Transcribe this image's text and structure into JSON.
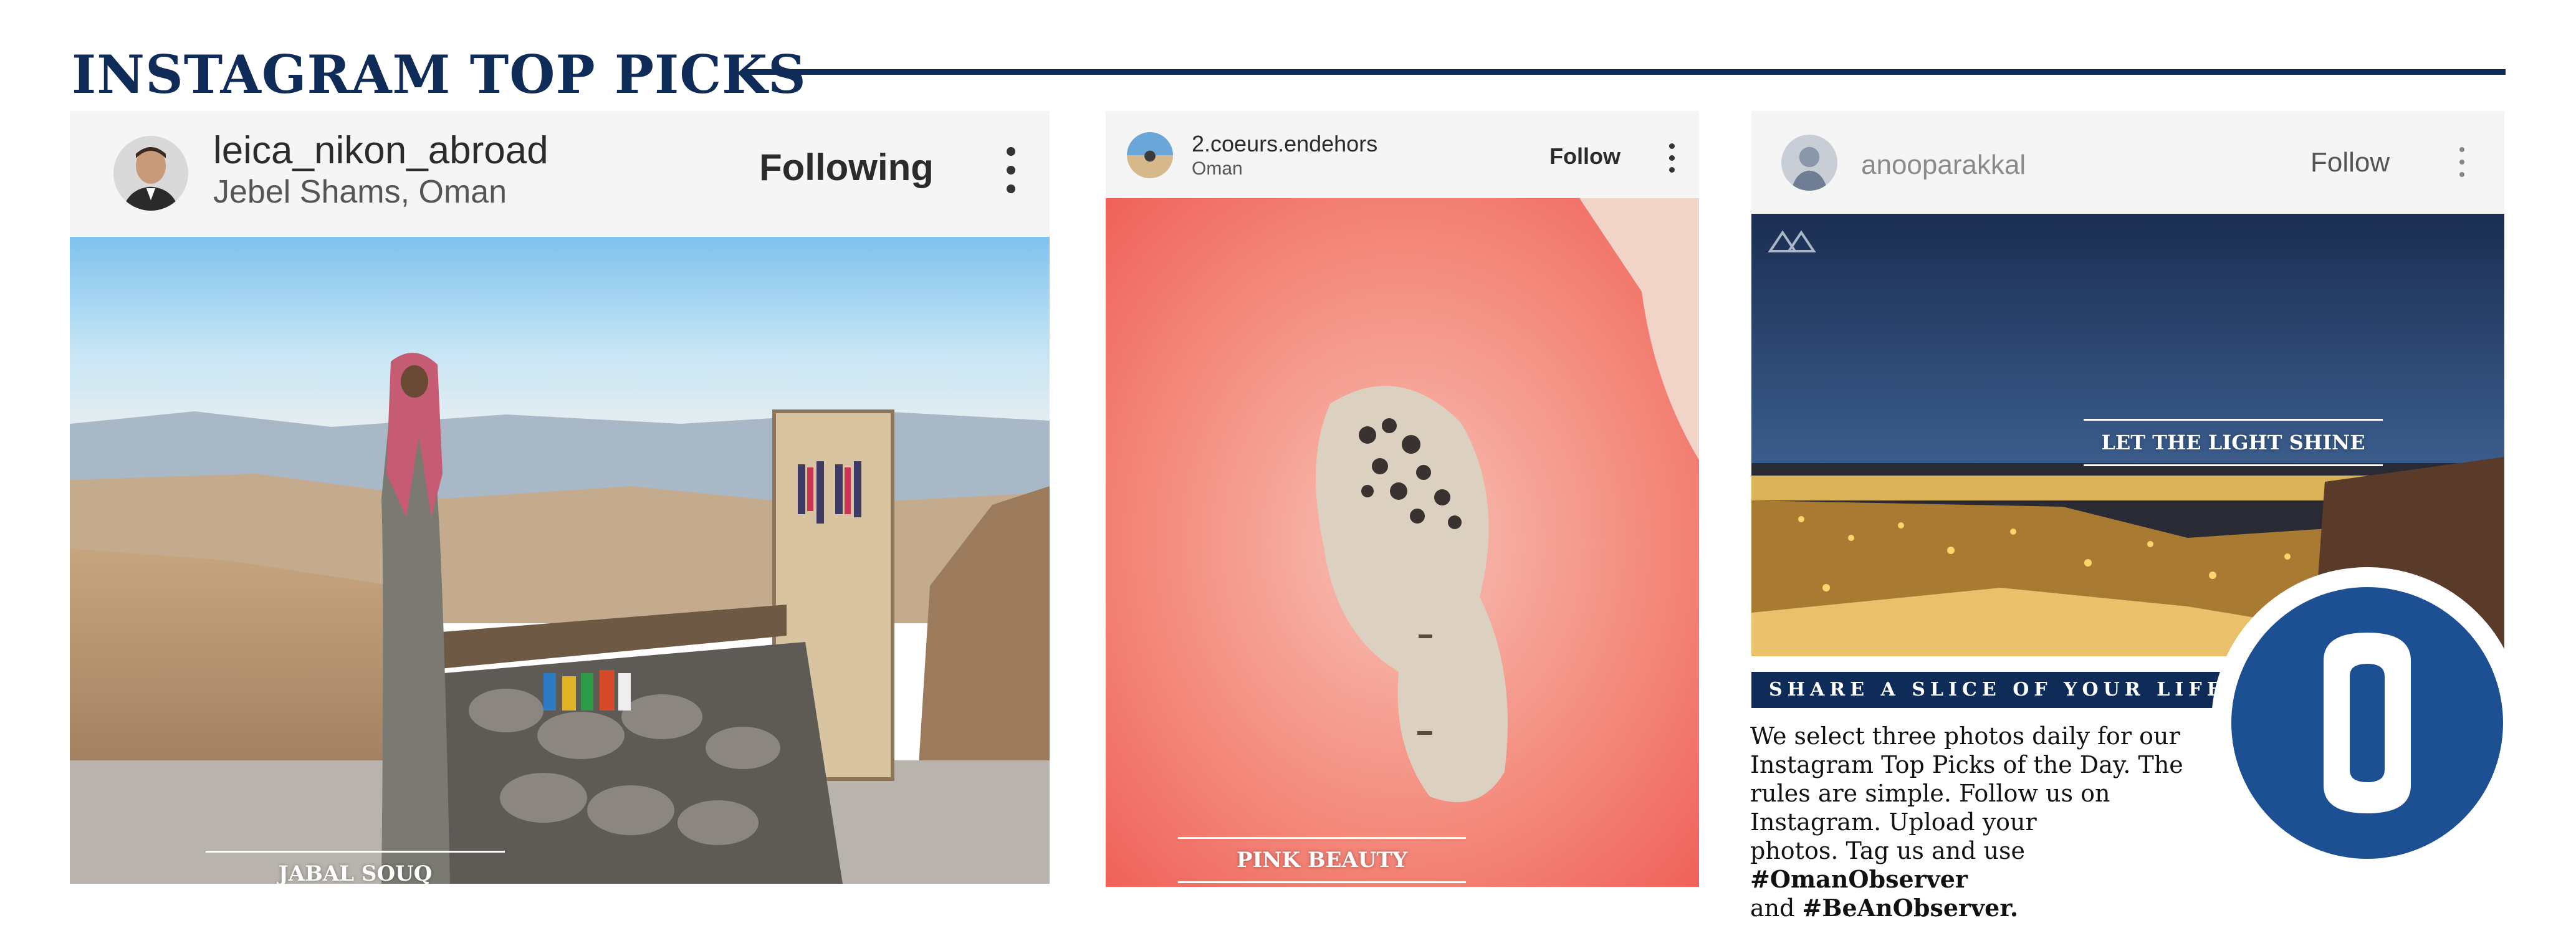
{
  "header": {
    "title": "INSTAGRAM TOP PICKS"
  },
  "posts": [
    {
      "username": "leica_nikon_abroad",
      "location": "Jebel Shams, Oman",
      "follow_label": "Following",
      "caption": "JABAL SOUQ",
      "avatar_icon": "user-avatar-icon",
      "menu_icon": "more-vertical-icon"
    },
    {
      "username": "2.coeurs.endehors",
      "location": "Oman",
      "follow_label": "Follow",
      "caption": "PINK BEAUTY",
      "avatar_icon": "user-avatar-icon",
      "menu_icon": "more-vertical-icon"
    },
    {
      "username": "anooparakkal",
      "location": "",
      "follow_label": "Follow",
      "caption": "LET THE LIGHT SHINE",
      "avatar_icon": "user-avatar-icon",
      "menu_icon": "more-vertical-icon"
    }
  ],
  "share": {
    "banner": "SHARE A SLICE OF YOUR LIFE",
    "body_line1": "We select three photos daily for our",
    "body_line2": "Instagram Top Picks of the Day. The",
    "body_line3": "rules are simple. Follow us on",
    "body_line4": "Instagram. Upload your",
    "body_line5_prefix": "photos. Tag us and use ",
    "hashtag1": "#OmanObserver",
    "body_line6_prefix": "and ",
    "hashtag2": "#BeAnObserver."
  },
  "logo": {
    "letter": "O",
    "icon": "oman-observer-logo-icon"
  },
  "colors": {
    "brand_navy": "#0f2b57",
    "logo_blue": "#1d4f93",
    "pink_lake": "#f0736a"
  }
}
